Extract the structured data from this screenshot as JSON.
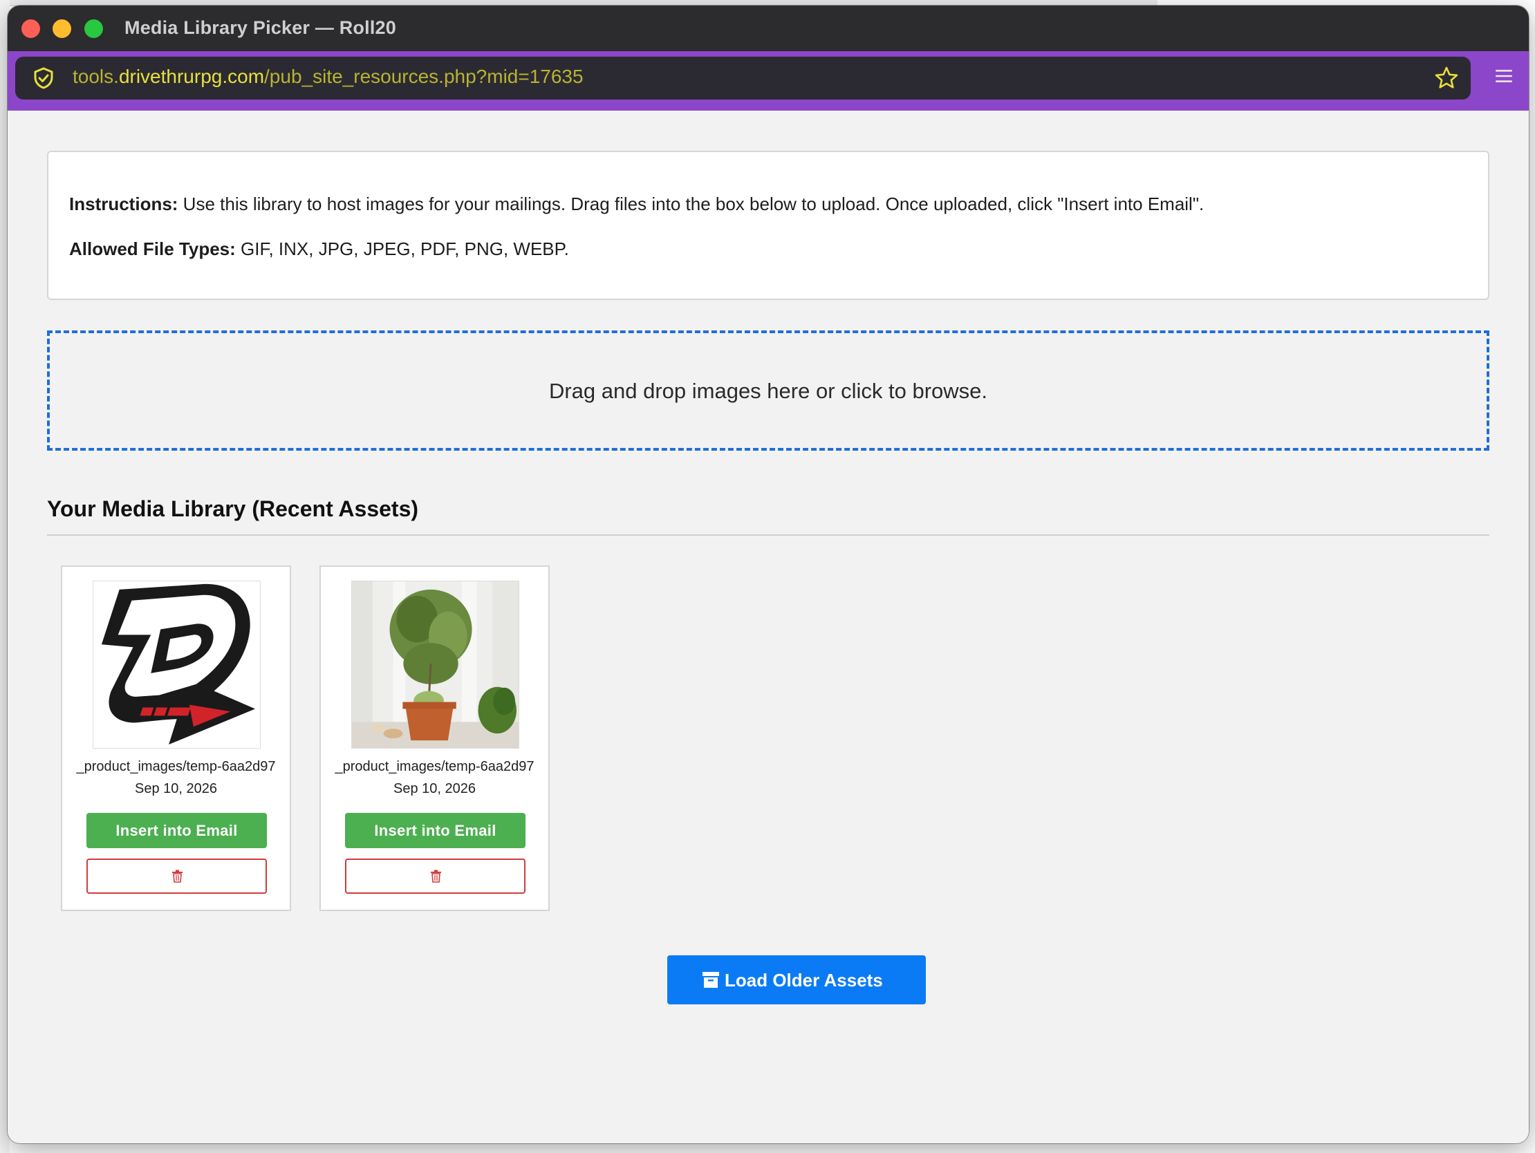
{
  "window": {
    "title": "Media Library Picker — Roll20"
  },
  "browser": {
    "url_prefix": "tools.",
    "url_domain": "drivethrurpg.com",
    "url_path": "/pub_site_resources.php?mid=17635",
    "toolbar_color": "#8c46c9"
  },
  "instructions": {
    "label": "Instructions:",
    "text": " Use this library to host images for your mailings. Drag files into the box below to upload. Once uploaded, click \"Insert into Email\".",
    "types_label": "Allowed File Types:",
    "types_text": " GIF, INX, JPG, JPEG, PDF, PNG, WEBP."
  },
  "dropzone": {
    "text": "Drag and drop images here or click to browse."
  },
  "library": {
    "title": "Your Media Library (Recent Assets)",
    "assets": [
      {
        "filename": "_product_images/temp-6aa2d97",
        "date": "Sep 10, 2026",
        "insert_label": "Insert into Email",
        "thumb_icon": "drivethru-logo-image"
      },
      {
        "filename": "_product_images/temp-6aa2d97",
        "date": "Sep 10, 2026",
        "insert_label": "Insert into Email",
        "thumb_icon": "potted-plant-image"
      }
    ]
  },
  "load_more": {
    "label": "Load Older Assets",
    "icon": "archive-icon"
  },
  "colors": {
    "insert": "#4caf50",
    "delete_border": "#d23c3c",
    "load_button": "#0b7bf5",
    "dropzone_border": "#1e6fd9"
  }
}
